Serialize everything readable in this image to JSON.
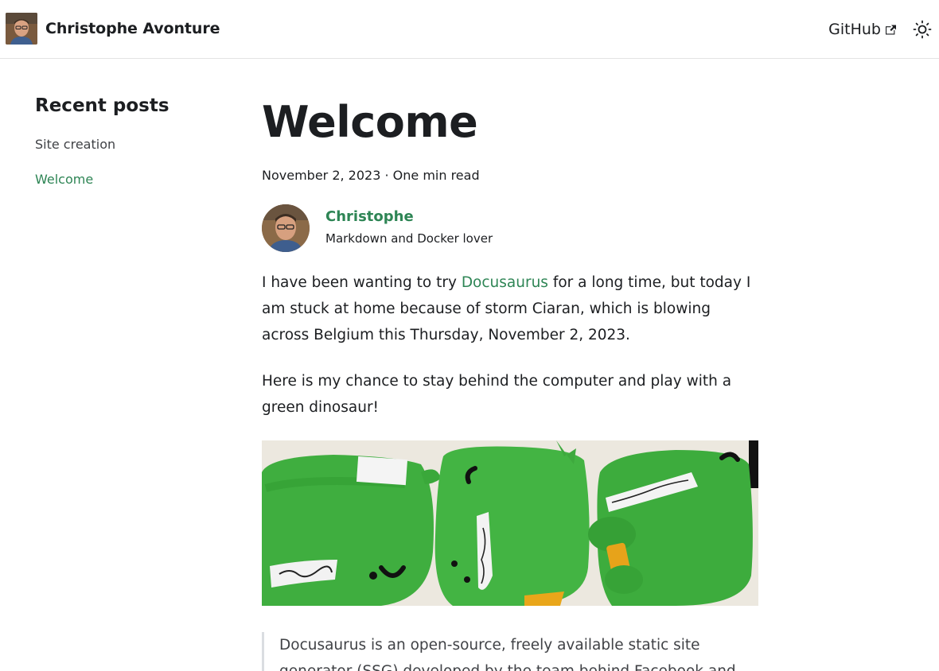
{
  "navbar": {
    "brand_title": "Christophe Avonture",
    "github_label": "GitHub",
    "logo_icon": "avatar-photo",
    "theme_icon": "sun-icon"
  },
  "sidebar": {
    "title": "Recent posts",
    "items": [
      {
        "label": "Site creation",
        "active": false
      },
      {
        "label": "Welcome",
        "active": true
      }
    ]
  },
  "post": {
    "title": "Welcome",
    "date": "November 2, 2023",
    "separator": " · ",
    "read_time": "One min read",
    "author": {
      "name": "Christophe",
      "title": "Markdown and Docker lover"
    },
    "paragraph1": {
      "before_link": "I have been wanting to try ",
      "link": "Docusaurus",
      "after_link": " for a long time, but today I am stuck at home because of storm Ciaran, which is blowing across Belgium this Thursday, November 2, 2023."
    },
    "paragraph2": "Here is my chance to stay behind the computer and play with a green dinosaur!",
    "quote": "Docusaurus is an open-source, freely available static site generator (SSG) developed by the team behind Facebook and"
  },
  "colors": {
    "accent": "#2e8555",
    "text": "#1c1e21",
    "border": "#e3e3e3"
  }
}
